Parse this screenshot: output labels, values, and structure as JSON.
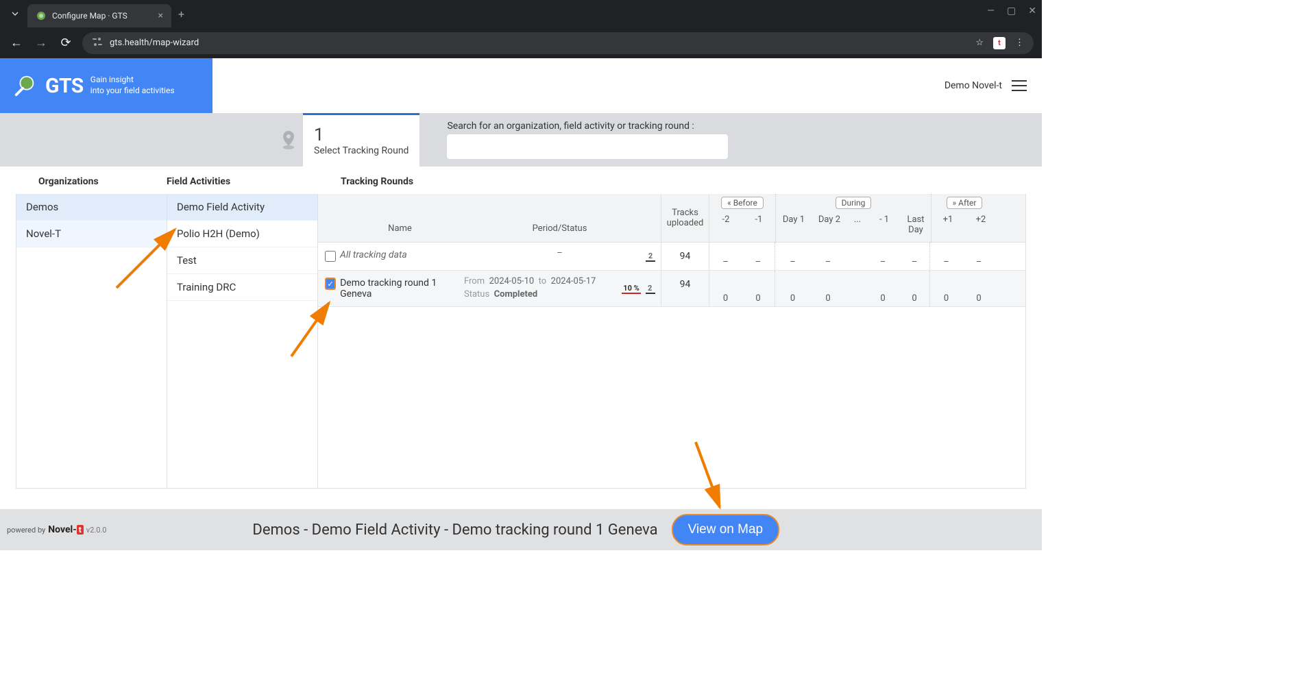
{
  "browser": {
    "tab_title": "Configure Map · GTS",
    "url_display": "gts.health/map-wizard",
    "url_prefix_icon": "site-settings"
  },
  "brand": {
    "name": "GTS",
    "tagline_l1": "Gain insight",
    "tagline_l2": "into your field activities"
  },
  "user": {
    "name": "Demo Novel-t"
  },
  "step": {
    "number": "1",
    "label": "Select Tracking Round"
  },
  "search": {
    "label": "Search for an organization, field activity or tracking round :",
    "placeholder": ""
  },
  "columns": {
    "org": "Organizations",
    "fa": "Field Activities",
    "tr": "Tracking Rounds"
  },
  "orgs": [
    "Demos",
    "Novel-T"
  ],
  "field_activities": [
    "Demo Field Activity",
    "Polio H2H (Demo)",
    "Test",
    "Training DRC"
  ],
  "table": {
    "head": {
      "name": "Name",
      "period": "Period/Status",
      "tracks": "Tracks uploaded",
      "before": "Before",
      "during": "During",
      "after": "After",
      "cols_before": [
        "-2",
        "-1"
      ],
      "cols_during": [
        "Day 1",
        "Day 2",
        "...",
        "- 1",
        "Last Day"
      ],
      "cols_after": [
        "+1",
        "+2"
      ]
    },
    "all_row": {
      "name": "All tracking data",
      "period_dash": "–",
      "count": "2",
      "tracks": "94",
      "dash": "–"
    },
    "row1": {
      "name": "Demo tracking round 1 Geneva",
      "from_lbl": "From",
      "from": "2024-05-10",
      "to_lbl": "to",
      "to": "2024-05-17",
      "status_lbl": "Status",
      "status": "Completed",
      "pct": "10 %",
      "count": "2",
      "tracks": "94",
      "zero": "0"
    }
  },
  "footer": {
    "powered": "powered by",
    "brand": "Novel-",
    "brand_t": "t",
    "version": "v2.0.0",
    "breadcrumb": "Demos - Demo Field Activity - Demo tracking round 1 Geneva",
    "view_btn": "View on Map"
  }
}
